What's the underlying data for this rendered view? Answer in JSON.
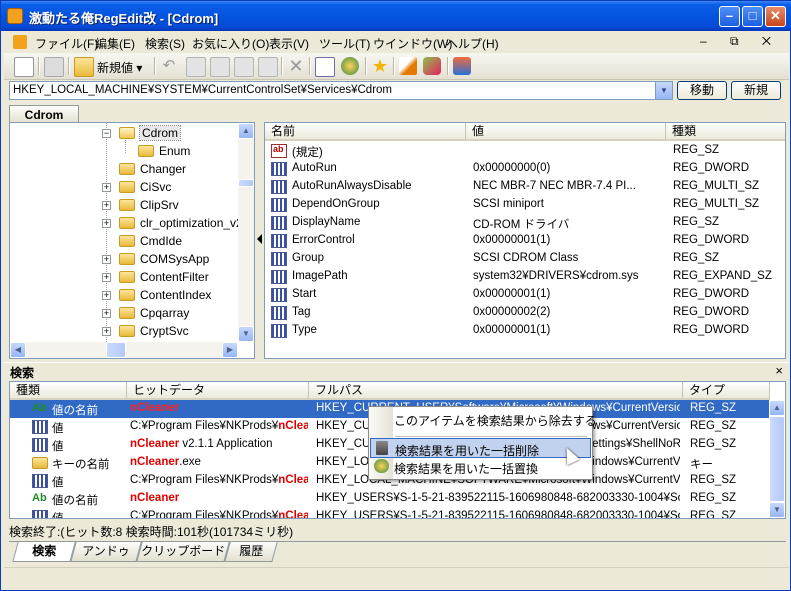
{
  "window": {
    "title": "激動たる俺RegEdit改 - [Cdrom]",
    "min": "–",
    "max": "□",
    "close": "✕"
  },
  "menu": [
    "ファイル(F)",
    "編集(E)",
    "検索(S)",
    "お気に入り(O)",
    "表示(V)",
    "ツール(T)",
    "ウインドウ(W)",
    "ヘルプ(H)"
  ],
  "mdi": "– ⧉ ✕",
  "toolbar": {
    "new_value": "新規値 ▾"
  },
  "address": {
    "value": "HKEY_LOCAL_MACHINE¥SYSTEM¥CurrentControlSet¥Services¥Cdrom",
    "move_button": "移動",
    "new_button": "新規"
  },
  "tree": {
    "tab": "Cdrom",
    "items": [
      {
        "label": "Cdrom",
        "expander": "−",
        "selected": true,
        "indent": 1
      },
      {
        "label": "Enum",
        "expander": "",
        "indent": 2
      },
      {
        "label": "Changer",
        "expander": "",
        "indent": 1
      },
      {
        "label": "CiSvc",
        "expander": "+",
        "indent": 1
      },
      {
        "label": "ClipSrv",
        "expander": "+",
        "indent": 1
      },
      {
        "label": "clr_optimization_v2.",
        "expander": "+",
        "indent": 1
      },
      {
        "label": "CmdIde",
        "expander": "",
        "indent": 1
      },
      {
        "label": "COMSysApp",
        "expander": "+",
        "indent": 1
      },
      {
        "label": "ContentFilter",
        "expander": "+",
        "indent": 1
      },
      {
        "label": "ContentIndex",
        "expander": "+",
        "indent": 1
      },
      {
        "label": "Cpqarray",
        "expander": "+",
        "indent": 1
      },
      {
        "label": "CryptSvc",
        "expander": "+",
        "indent": 1
      }
    ]
  },
  "values": {
    "headers": [
      "名前",
      "値",
      "種類"
    ],
    "rows": [
      {
        "name": "(規定)",
        "value": "",
        "type": "REG_SZ",
        "kind": "sz"
      },
      {
        "name": "AutoRun",
        "value": "0x00000000(0)",
        "type": "REG_DWORD",
        "kind": "bin"
      },
      {
        "name": "AutoRunAlwaysDisable",
        "value": "NEC    MBR-7   NEC    MBR-7.4 PI...",
        "type": "REG_MULTI_SZ",
        "kind": "bin"
      },
      {
        "name": "DependOnGroup",
        "value": "SCSI miniport",
        "type": "REG_MULTI_SZ",
        "kind": "bin"
      },
      {
        "name": "DisplayName",
        "value": "CD-ROM ドライバ",
        "type": "REG_SZ",
        "kind": "bin"
      },
      {
        "name": "ErrorControl",
        "value": "0x00000001(1)",
        "type": "REG_DWORD",
        "kind": "bin"
      },
      {
        "name": "Group",
        "value": "SCSI CDROM Class",
        "type": "REG_SZ",
        "kind": "bin"
      },
      {
        "name": "ImagePath",
        "value": "system32¥DRIVERS¥cdrom.sys",
        "type": "REG_EXPAND_SZ",
        "kind": "bin"
      },
      {
        "name": "Start",
        "value": "0x00000001(1)",
        "type": "REG_DWORD",
        "kind": "bin"
      },
      {
        "name": "Tag",
        "value": "0x00000002(2)",
        "type": "REG_DWORD",
        "kind": "bin"
      },
      {
        "name": "Type",
        "value": "0x00000001(1)",
        "type": "REG_DWORD",
        "kind": "bin"
      }
    ]
  },
  "search": {
    "title": "検索",
    "close": "×",
    "headers": [
      "種類",
      "ヒットデータ",
      "フルパス",
      "タイプ"
    ],
    "rows": [
      {
        "kind": "値の名前",
        "hit_pre": "",
        "hit_red": "nCleaner",
        "hit_post": "",
        "path": "HKEY_CURRENT_USER¥Software¥Microsoft¥Windows¥CurrentVersion¥R...",
        "type": "REG_SZ",
        "highlight": true,
        "icon": "ab"
      },
      {
        "kind": "値",
        "hit_pre": "C:¥Program Files¥NKProds¥",
        "hit_red": "nCleane",
        "hit_post": "",
        "path": "HKEY_CURRENT_USER¥Software¥Microsoft¥Windows¥CurrentVersion¥R...",
        "type": "REG_SZ",
        "highlight": false,
        "icon": "reg"
      },
      {
        "kind": "値",
        "hit_pre": "",
        "hit_red": "nCleaner",
        "hit_post": " v2.1.1 Application",
        "path": "HKEY_CURRENT_USER¥Software¥Classes¥Local Settings¥ShellNoRoam¥MU...",
        "type": "REG_SZ",
        "highlight": false,
        "icon": "reg"
      },
      {
        "kind": "キーの名前",
        "hit_pre": "",
        "hit_red": "nCleaner",
        "hit_post": ".exe",
        "path": "HKEY_LOCAL_MACHINE¥SOFTWARE¥Microsoft¥Windows¥CurrentVersio...",
        "type": "キー",
        "highlight": false,
        "icon": "key"
      },
      {
        "kind": "値",
        "hit_pre": "C:¥Program Files¥NKProds¥",
        "hit_red": "nCleane",
        "hit_post": "",
        "path": "HKEY_LOCAL_MACHINE¥SOFTWARE¥Microsoft¥Windows¥CurrentVersion¥R...",
        "type": "REG_SZ",
        "highlight": false,
        "icon": "reg"
      },
      {
        "kind": "値の名前",
        "hit_pre": "",
        "hit_red": "nCleaner",
        "hit_post": "",
        "path": "HKEY_USERS¥S-1-5-21-839522115-1606980848-682003330-1004¥Soft...",
        "type": "REG_SZ",
        "highlight": false,
        "icon": "ab"
      },
      {
        "kind": "値",
        "hit_pre": "C:¥Program Files¥NKProds¥",
        "hit_red": "nCleane",
        "hit_post": "",
        "path": "HKEY_USERS¥S-1-5-21-839522115-1606980848-682003330-1004¥Soft...",
        "type": "REG_SZ",
        "highlight": false,
        "icon": "reg"
      }
    ],
    "status": "検索終了:(ヒット数:8  検索時間:101秒(101734ミリ秒)"
  },
  "context_menu": {
    "items": [
      "このアイテムを検索結果から除去する",
      "検索結果を用いた一括削除",
      "検索結果を用いた一括置換"
    ]
  },
  "bottom_tabs": [
    "検索",
    "アンドゥ",
    "クリップボード",
    "履歴"
  ]
}
